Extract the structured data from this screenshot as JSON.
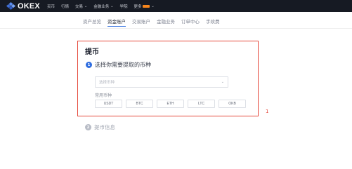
{
  "brand": {
    "logo_text": "OKEX"
  },
  "topnav": {
    "items": [
      {
        "label": "买币",
        "has_dropdown": false
      },
      {
        "label": "行情",
        "has_dropdown": false
      },
      {
        "label": "交易",
        "has_dropdown": true
      },
      {
        "label": "金融业务",
        "has_dropdown": true
      },
      {
        "label": "学院",
        "has_dropdown": false
      },
      {
        "label": "更多",
        "has_dropdown": true,
        "has_new_badge": true
      }
    ]
  },
  "subnav": {
    "tabs": [
      {
        "label": "资产总览",
        "active": false
      },
      {
        "label": "资金账户",
        "active": true
      },
      {
        "label": "交易账户",
        "active": false
      },
      {
        "label": "金融业务",
        "active": false
      },
      {
        "label": "订单中心",
        "active": false
      },
      {
        "label": "手续费",
        "active": false
      }
    ]
  },
  "withdraw": {
    "title": "提币",
    "step1": {
      "number": "1",
      "label": "选择你需要提取的币种"
    },
    "select": {
      "placeholder": "选择币种"
    },
    "common_label": "常用币种",
    "coins": [
      "USDT",
      "BTC",
      "ETH",
      "LTC",
      "OKB"
    ],
    "step2": {
      "number": "2",
      "label": "提币信息"
    }
  },
  "annotation": {
    "marker": "1"
  },
  "colors": {
    "topbar": "#161a23",
    "accent": "#2d6cdf",
    "highlight_border": "#e5483b",
    "badge": "#f6851b"
  }
}
